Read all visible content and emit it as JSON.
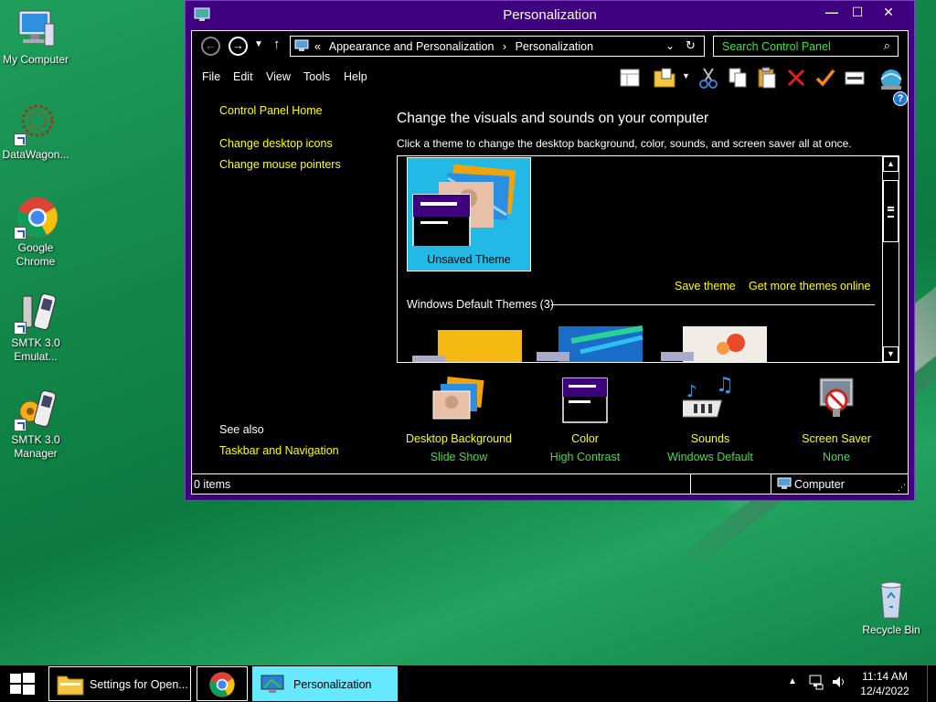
{
  "desktop": {
    "icons": [
      {
        "name": "my-computer",
        "label": "My Computer"
      },
      {
        "name": "datawagon",
        "label": "DataWagon..."
      },
      {
        "name": "google-chrome",
        "label": "Google Chrome"
      },
      {
        "name": "smtk-emulator",
        "label": "SMTK 3.0 Emulat..."
      },
      {
        "name": "smtk-manager",
        "label": "SMTK 3.0 Manager"
      },
      {
        "name": "recycle-bin",
        "label": "Recycle Bin"
      }
    ]
  },
  "window": {
    "title": "Personalization",
    "buttons": {
      "minimize": "—",
      "maximize": "☐",
      "close": "✕"
    },
    "address": {
      "prefix": "«",
      "crumbs": [
        "Appearance and Personalization",
        "Personalization"
      ],
      "separator": "›"
    },
    "search_placeholder": "Search Control Panel",
    "menus": [
      "File",
      "Edit",
      "View",
      "Tools",
      "Help"
    ],
    "left_links": [
      "Control Panel Home",
      "Change desktop icons",
      "Change mouse pointers"
    ],
    "see_also": {
      "label": "See also",
      "links": [
        "Taskbar and Navigation"
      ]
    },
    "heading": "Change the visuals and sounds on your computer",
    "subheading": "Click a theme to change the desktop background, color, sounds, and screen saver all at once.",
    "themes": {
      "current": "Unsaved Theme",
      "save": "Save theme",
      "get_more": "Get more themes online",
      "section": "Windows Default Themes (3)"
    },
    "bottom": [
      {
        "title": "Desktop Background",
        "value": "Slide Show"
      },
      {
        "title": "Color",
        "value": "High Contrast"
      },
      {
        "title": "Sounds",
        "value": "Windows Default"
      },
      {
        "title": "Screen Saver",
        "value": "None"
      }
    ],
    "status": {
      "items": "0 items",
      "location": "Computer"
    }
  },
  "taskbar": {
    "buttons": [
      "Settings for Open...",
      "Personalization"
    ],
    "time": "11:14 AM",
    "date": "12/4/2022"
  },
  "colors": {
    "frame": "#3f007e",
    "link": "#ffff00",
    "value": "#40e040",
    "active_task": "#66e8ff"
  }
}
